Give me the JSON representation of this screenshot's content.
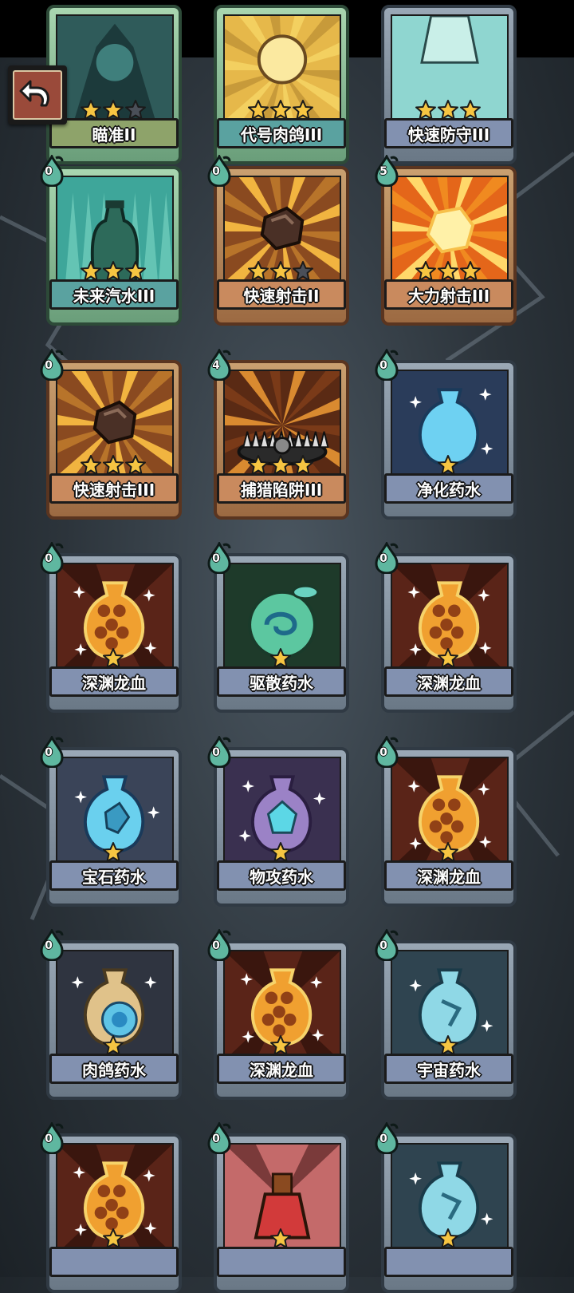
{
  "back_button": {
    "icon": "back-arrow-icon"
  },
  "cards": [
    {
      "name": "瞄准II",
      "cost": "",
      "stars": 2,
      "max_stars": 3,
      "frame": "green",
      "bar": "olive",
      "art": "dark-teal"
    },
    {
      "name": "代号肉鸽III",
      "cost": "",
      "stars": 3,
      "max_stars": 3,
      "frame": "green",
      "bar": "green",
      "art": "gold-burst"
    },
    {
      "name": "快速防守III",
      "cost": "",
      "stars": 3,
      "max_stars": 3,
      "frame": "silver",
      "bar": "silver",
      "art": "light-teal"
    },
    {
      "name": "未来汽水III",
      "cost": "0",
      "stars": 3,
      "max_stars": 3,
      "frame": "green",
      "bar": "green",
      "art": "soda-bottle"
    },
    {
      "name": "快速射击II",
      "cost": "0",
      "stars": 2,
      "max_stars": 3,
      "frame": "gold",
      "bar": "gold",
      "art": "rock-burst"
    },
    {
      "name": "大力射击III",
      "cost": "5",
      "stars": 3,
      "max_stars": 3,
      "frame": "gold",
      "bar": "gold",
      "art": "fire-burst"
    },
    {
      "name": "快速射击III",
      "cost": "0",
      "stars": 3,
      "max_stars": 3,
      "frame": "gold",
      "bar": "gold",
      "art": "rock-burst"
    },
    {
      "name": "捕猎陷阱III",
      "cost": "4",
      "stars": 3,
      "max_stars": 3,
      "frame": "gold",
      "bar": "gold",
      "art": "trap"
    },
    {
      "name": "净化药水",
      "cost": "0",
      "stars": 1,
      "max_stars": 1,
      "frame": "silver",
      "bar": "silver",
      "art": "potion-blue"
    },
    {
      "name": "深渊龙血",
      "cost": "0",
      "stars": 1,
      "max_stars": 1,
      "frame": "silver",
      "bar": "silver",
      "art": "potion-lava"
    },
    {
      "name": "驱散药水",
      "cost": "0",
      "stars": 1,
      "max_stars": 1,
      "frame": "silver",
      "bar": "silver",
      "art": "potion-green"
    },
    {
      "name": "深渊龙血",
      "cost": "0",
      "stars": 1,
      "max_stars": 1,
      "frame": "silver",
      "bar": "silver",
      "art": "potion-lava"
    },
    {
      "name": "宝石药水",
      "cost": "0",
      "stars": 1,
      "max_stars": 1,
      "frame": "silver",
      "bar": "silver",
      "art": "potion-gem"
    },
    {
      "name": "物攻药水",
      "cost": "0",
      "stars": 1,
      "max_stars": 1,
      "frame": "silver",
      "bar": "silver",
      "art": "potion-purple"
    },
    {
      "name": "深渊龙血",
      "cost": "0",
      "stars": 1,
      "max_stars": 1,
      "frame": "silver",
      "bar": "silver",
      "art": "potion-lava"
    },
    {
      "name": "肉鸽药水",
      "cost": "0",
      "stars": 1,
      "max_stars": 1,
      "frame": "silver",
      "bar": "silver",
      "art": "potion-tan"
    },
    {
      "name": "深渊龙血",
      "cost": "0",
      "stars": 1,
      "max_stars": 1,
      "frame": "silver",
      "bar": "silver",
      "art": "potion-lava"
    },
    {
      "name": "宇宙药水",
      "cost": "0",
      "stars": 1,
      "max_stars": 1,
      "frame": "silver",
      "bar": "silver",
      "art": "potion-cosmic"
    },
    {
      "name": "",
      "cost": "0",
      "stars": 1,
      "max_stars": 1,
      "frame": "silver",
      "bar": "silver",
      "art": "potion-lava"
    },
    {
      "name": "",
      "cost": "0",
      "stars": 1,
      "max_stars": 1,
      "frame": "silver",
      "bar": "silver",
      "art": "potion-red"
    },
    {
      "name": "",
      "cost": "0",
      "stars": 1,
      "max_stars": 1,
      "frame": "silver",
      "bar": "silver",
      "art": "potion-cosmic"
    }
  ],
  "colors": {
    "star_filled": "#f6c542",
    "star_empty": "#4a4f58",
    "cost_drop": "#5fb7a0"
  }
}
